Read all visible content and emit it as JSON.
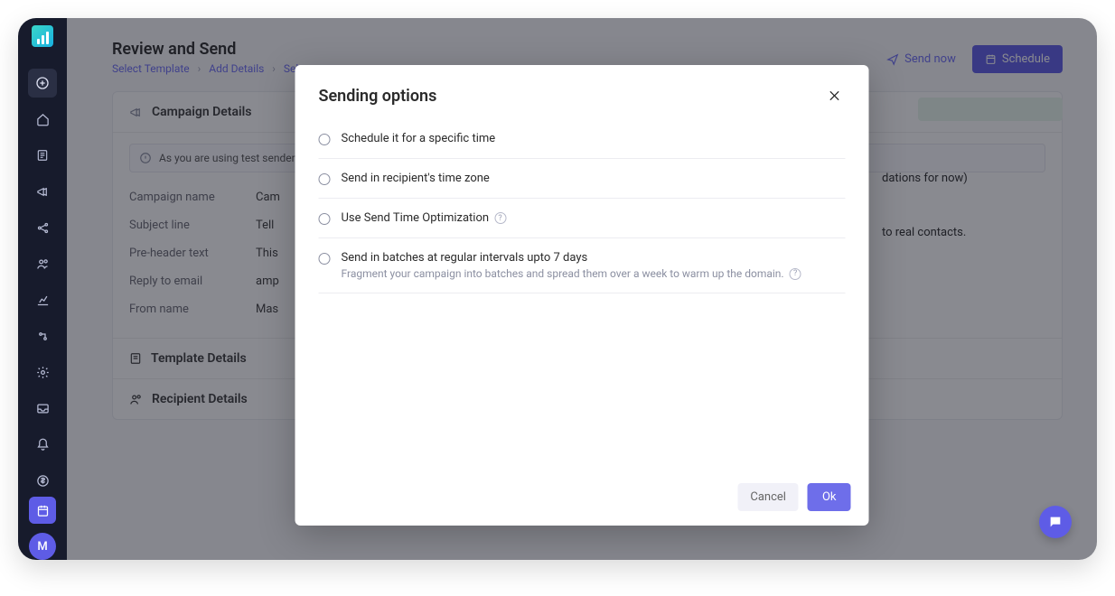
{
  "page": {
    "title": "Review and Send",
    "breadcrumbs": [
      "Select Template",
      "Add Details",
      "Select"
    ]
  },
  "header_actions": {
    "send_now": "Send now",
    "schedule": "Schedule"
  },
  "campaign_details": {
    "heading": "Campaign Details",
    "notice": "As you are using test sender id",
    "fields": {
      "campaign_name": {
        "label": "Campaign name",
        "value": "Cam"
      },
      "subject_line": {
        "label": "Subject line",
        "value": "Tell"
      },
      "pre_header": {
        "label": "Pre-header text",
        "value": "This"
      },
      "reply_to": {
        "label": "Reply to email",
        "value": "amp"
      },
      "from_name": {
        "label": "From name",
        "value": "Mas"
      }
    }
  },
  "sections": {
    "template_details": "Template Details",
    "recipient_details": "Recipient Details"
  },
  "background_fragments": {
    "frag1": "dations for now)",
    "frag2": "to real contacts."
  },
  "modal": {
    "title": "Sending options",
    "options": [
      {
        "label": "Schedule it for a specific time"
      },
      {
        "label": "Send in recipient's time zone"
      },
      {
        "label": "Use Send Time Optimization",
        "hint": true
      },
      {
        "label": "Send in batches at regular intervals upto 7 days",
        "sub": "Fragment your campaign into batches and spread them over a week to warm up the domain.",
        "sub_hint": true
      }
    ],
    "cancel": "Cancel",
    "ok": "Ok"
  },
  "avatar_letter": "M"
}
